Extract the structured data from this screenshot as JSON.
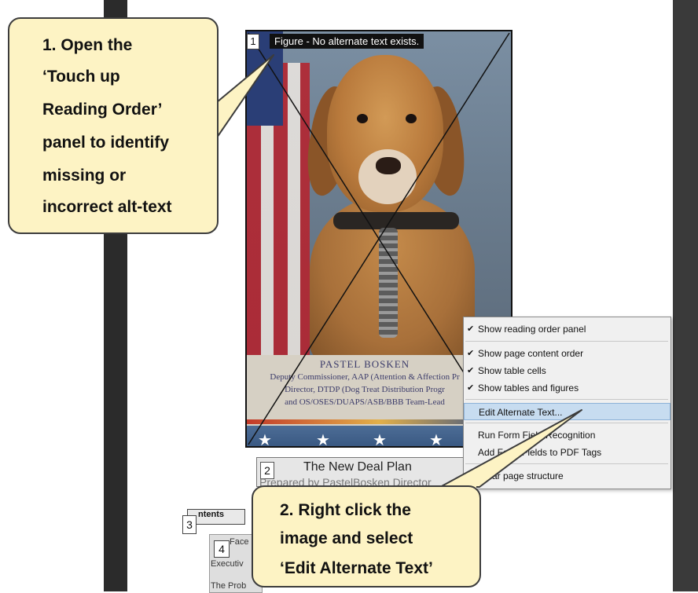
{
  "figure": {
    "tag": "1",
    "label": "Figure - No alternate text exists.",
    "caption_name": "PASTEL BOSKEN",
    "caption_lines": [
      "Deputy Commissioner, AAP (Attention & Affection Pr",
      "Director, DTDP (Dog Treat Distribution Progr",
      "and OS/OSES/DUAPS/ASB/BBB Team-Lead"
    ],
    "stars": [
      "★",
      "★",
      "★",
      "★"
    ]
  },
  "heading_block": {
    "tag": "2",
    "title": "The New Deal Plan",
    "subtitle": "Prepared by PastelBosken Director"
  },
  "contents_block": {
    "tag": "3",
    "label": "ntents"
  },
  "toc_block": {
    "tag": "4",
    "items": [
      "Face",
      "Executiv",
      "The Prob"
    ]
  },
  "context_menu": {
    "items": [
      {
        "label": "Show reading order panel",
        "checked": true
      },
      {
        "label": "Show page content order",
        "checked": true
      },
      {
        "label": "Show table cells",
        "checked": true
      },
      {
        "label": "Show tables and figures",
        "checked": true
      },
      {
        "label": "Edit Alternate Text...",
        "checked": false,
        "highlighted": true
      },
      {
        "label": "Run Form Field Recognition",
        "checked": false
      },
      {
        "label": "Add Form Fields to PDF Tags",
        "checked": false
      },
      {
        "label": "Clear page structure",
        "checked": false
      }
    ],
    "checkmark": "✔"
  },
  "callouts": {
    "first": {
      "lines": [
        "1. Open the",
        "‘Touch up",
        "Reading Order’",
        "panel to identify",
        "missing or",
        "incorrect alt-text"
      ]
    },
    "second": {
      "lines": [
        "2. Right click the",
        "image and select",
        "‘Edit Alternate Text’"
      ]
    }
  },
  "colors": {
    "callout_fill": "#fdf3c4",
    "menu_highlight": "#c7dcf0",
    "frame_dark": "#2b2b2b"
  }
}
